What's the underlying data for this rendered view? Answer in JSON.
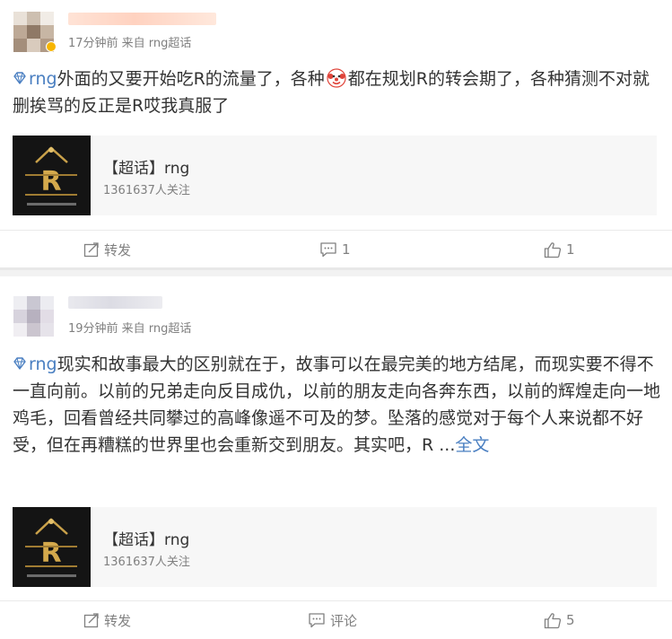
{
  "topic_label": "rng",
  "posts": [
    {
      "meta": "17分钟前 来自 rng超话",
      "text_before_emoji": "外面的又要开始吃R的流量了，各种",
      "emoji_icon": "clown-face-icon",
      "text_after_emoji": "都在规划R的转会期了，各种猜测不对就删挨骂的反正是R哎我真服了",
      "card": {
        "title": "【超话】rng",
        "followers": "1361637人关注"
      },
      "actions": {
        "repost": "转发",
        "comment": "1",
        "like": "1"
      }
    },
    {
      "meta": "19分钟前 来自 rng超话",
      "text": "现实和故事最大的区别就在于，故事可以在最完美的地方结尾，而现实要不得不一直向前。以前的兄弟走向反目成仇，以前的朋友走向各奔东西，以前的辉煌走向一地鸡毛，回看曾经共同攀过的高峰像遥不可及的梦。坠落的感觉对于每个人来说都不好受，但在再糟糕的世界里也会重新交到朋友。其实吧，R ...",
      "expand_link": "全文",
      "card": {
        "title": "【超话】rng",
        "followers": "1361637人关注"
      },
      "actions": {
        "repost": "转发",
        "comment": "评论",
        "like": "5"
      }
    }
  ],
  "colors": {
    "link": "#4a7fc1",
    "meta_gray": "#808080",
    "card_bg": "#f7f7f7",
    "separator": "#f2f2f2",
    "vip_badge": "#f7b500"
  }
}
